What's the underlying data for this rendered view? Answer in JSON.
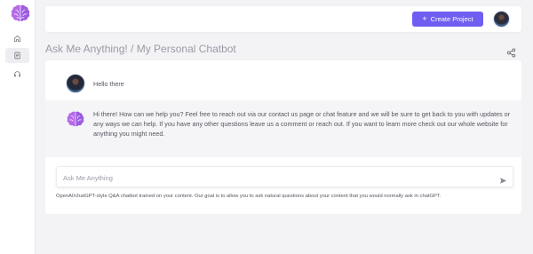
{
  "app": {
    "logo_icon": "brain-icon",
    "accent_color": "#6e5ff0",
    "logo_color": "#b56ae8"
  },
  "sidebar": {
    "items": [
      {
        "icon": "home-icon",
        "active": false
      },
      {
        "icon": "document-icon",
        "active": true
      },
      {
        "icon": "headset-icon",
        "active": false
      }
    ]
  },
  "topbar": {
    "create_button_label": "Create Project",
    "create_button_icon": "plus-icon",
    "user_avatar": "user-avatar"
  },
  "page": {
    "title": "Ask Me Anything! / My Personal Chatbot",
    "share_icon": "share-icon"
  },
  "chat": {
    "messages": [
      {
        "role": "user",
        "text": "Hello there"
      },
      {
        "role": "bot",
        "text": "Hi there! How can we help you? Feel free to reach out via our contact us page or chat feature and we will be sure to get back to you with updates or any ways we can help. If you have any other questions leave us a comment or reach out. If you want to learn more check out our whole website for anything you might need."
      }
    ],
    "input": {
      "value": "",
      "placeholder": "Ask Me Anything",
      "send_icon": "send-icon"
    },
    "disclaimer": "OpenAI/chatGPT-style Q&A chatbot trained on your content. Our goal is to allow you to ask natural questions about your content that you would normally ask in chatGPT."
  }
}
